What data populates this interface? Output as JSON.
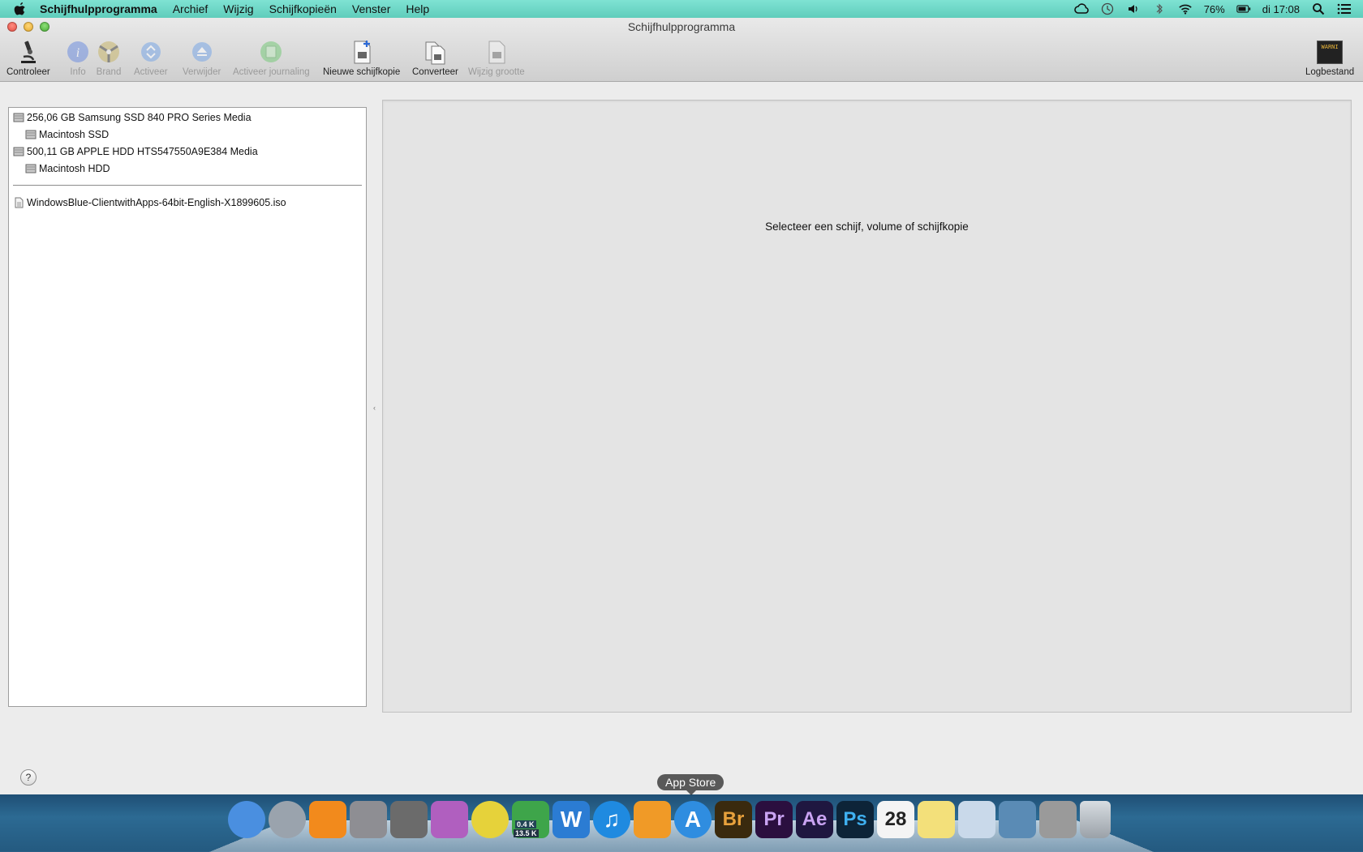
{
  "menubar": {
    "app_name": "Schijfhulpprogramma",
    "menus": [
      "Archief",
      "Wijzig",
      "Schijfkopieën",
      "Venster",
      "Help"
    ],
    "battery": "76%",
    "clock": "di 17:08"
  },
  "window": {
    "title": "Schijfhulpprogramma"
  },
  "toolbar": {
    "controleer": "Controleer",
    "info": "Info",
    "brand": "Brand",
    "activeer": "Activeer",
    "verwijder": "Verwijder",
    "activeer_journaling": "Activeer journaling",
    "nieuwe_schijfkopie": "Nieuwe schijfkopie",
    "converteer": "Converteer",
    "wijzig_grootte": "Wijzig grootte",
    "logbestand": "Logbestand",
    "log_icon_text": "WARNI"
  },
  "disks": {
    "disk1": "256,06 GB Samsung SSD 840 PRO Series Media",
    "volume1": "Macintosh SSD",
    "disk2": "500,11 GB APPLE HDD HTS547550A9E384 Media",
    "volume2": "Macintosh HDD",
    "image1": "WindowsBlue-ClientwithApps-64bit-English-X1899605.iso"
  },
  "main": {
    "hint": "Selecteer een schijf, volume of schijfkopie"
  },
  "dock": {
    "tooltip": "App Store",
    "network_up": "0.4 K",
    "network_down": "13.5 K",
    "calendar_day": "28",
    "items": [
      {
        "name": "finder",
        "color": "#4a8fe0",
        "text": ""
      },
      {
        "name": "launchpad",
        "color": "#9aa3ad",
        "text": ""
      },
      {
        "name": "vlc",
        "color": "#f28a1c",
        "text": ""
      },
      {
        "name": "system-preferences",
        "color": "#8e8e93",
        "text": ""
      },
      {
        "name": "image-capture",
        "color": "#6b6b6b",
        "text": ""
      },
      {
        "name": "imac",
        "color": "#b05fbf",
        "text": ""
      },
      {
        "name": "chrome",
        "color": "#e6d23a",
        "text": ""
      },
      {
        "name": "network-monitor",
        "color": "#3ea54a",
        "text": ""
      },
      {
        "name": "word",
        "color": "#2b7cd3",
        "text": "W"
      },
      {
        "name": "itunes",
        "color": "#1f8ae0",
        "text": "♫"
      },
      {
        "name": "ibooks",
        "color": "#f09a27",
        "text": ""
      },
      {
        "name": "app-store",
        "color": "#2f8de0",
        "text": "A"
      },
      {
        "name": "bridge",
        "color": "#3a2a0e",
        "text": "Br"
      },
      {
        "name": "premiere",
        "color": "#2b0f3f",
        "text": "Pr"
      },
      {
        "name": "after-effects",
        "color": "#1f1740",
        "text": "Ae"
      },
      {
        "name": "photoshop",
        "color": "#0d2438",
        "text": "Ps"
      },
      {
        "name": "calendar",
        "color": "#f4f4f4",
        "text": "28"
      },
      {
        "name": "notes",
        "color": "#f3e07a",
        "text": ""
      },
      {
        "name": "preview",
        "color": "#c9d9ea",
        "text": ""
      },
      {
        "name": "iphoto",
        "color": "#5a8bb5",
        "text": ""
      },
      {
        "name": "disk-utility",
        "color": "#9a9a9a",
        "text": ""
      },
      {
        "name": "trash",
        "color": "#b8bec4",
        "text": ""
      }
    ]
  }
}
